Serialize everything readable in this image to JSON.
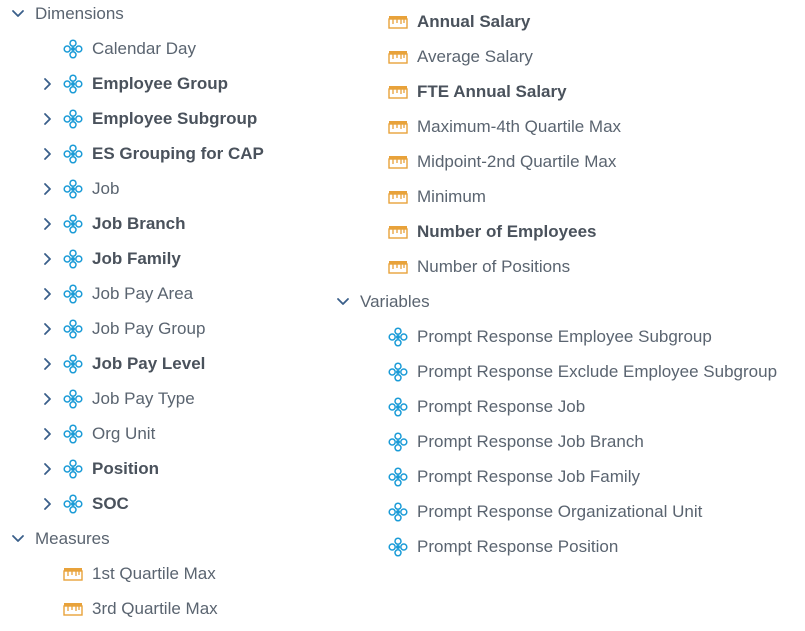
{
  "colors": {
    "chevron": "#3a5f8a",
    "dimension_icon": "#1a9bd7",
    "measure_icon": "#e8a23a",
    "text": "#5a6470"
  },
  "left_column": {
    "dimensions": {
      "label": "Dimensions",
      "expanded": true,
      "items": [
        {
          "label": "Calendar Day",
          "bold": false,
          "has_children": false
        },
        {
          "label": "Employee Group",
          "bold": true,
          "has_children": true
        },
        {
          "label": "Employee Subgroup",
          "bold": true,
          "has_children": true
        },
        {
          "label": "ES Grouping for CAP",
          "bold": true,
          "has_children": true
        },
        {
          "label": "Job",
          "bold": false,
          "has_children": true
        },
        {
          "label": "Job Branch",
          "bold": true,
          "has_children": true
        },
        {
          "label": "Job Family",
          "bold": true,
          "has_children": true
        },
        {
          "label": "Job Pay Area",
          "bold": false,
          "has_children": true
        },
        {
          "label": "Job Pay Group",
          "bold": false,
          "has_children": true
        },
        {
          "label": "Job Pay Level",
          "bold": true,
          "has_children": true
        },
        {
          "label": "Job Pay Type",
          "bold": false,
          "has_children": true
        },
        {
          "label": "Org Unit",
          "bold": false,
          "has_children": true
        },
        {
          "label": "Position",
          "bold": true,
          "has_children": true
        },
        {
          "label": "SOC",
          "bold": true,
          "has_children": true
        }
      ]
    },
    "measures": {
      "label": "Measures",
      "expanded": true,
      "items": [
        {
          "label": "1st Quartile Max",
          "bold": false
        },
        {
          "label": "3rd Quartile Max",
          "bold": false
        }
      ]
    }
  },
  "right_column": {
    "measures_continued": [
      {
        "label": "Annual Salary",
        "bold": true
      },
      {
        "label": "Average Salary",
        "bold": false
      },
      {
        "label": "FTE Annual Salary",
        "bold": true
      },
      {
        "label": "Maximum-4th Quartile Max",
        "bold": false
      },
      {
        "label": "Midpoint-2nd Quartile Max",
        "bold": false
      },
      {
        "label": "Minimum",
        "bold": false
      },
      {
        "label": "Number of Employees",
        "bold": true
      },
      {
        "label": "Number of Positions",
        "bold": false
      }
    ],
    "variables": {
      "label": "Variables",
      "expanded": true,
      "items": [
        {
          "label": "Prompt Response Employee Subgroup",
          "bold": false
        },
        {
          "label": "Prompt Response Exclude Employee Subgroup",
          "bold": false
        },
        {
          "label": "Prompt Response Job",
          "bold": false
        },
        {
          "label": "Prompt Response Job Branch",
          "bold": false
        },
        {
          "label": "Prompt Response Job Family",
          "bold": false
        },
        {
          "label": "Prompt Response Organizational Unit",
          "bold": false
        },
        {
          "label": "Prompt Response Position",
          "bold": false
        }
      ]
    }
  }
}
